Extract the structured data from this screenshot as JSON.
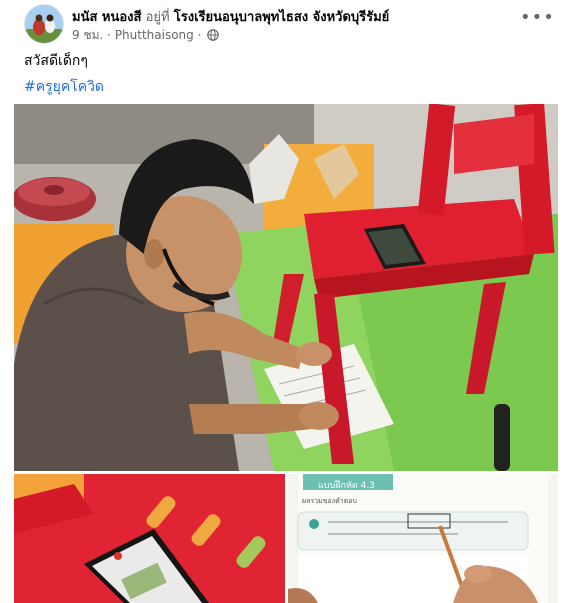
{
  "post": {
    "author_name": "มนัส หนองสี",
    "at_word": "อยู่ที่",
    "place_name": "โรงเรียนอนุบาลพุทไธสง จังหวัดบุรีรัมย์",
    "time": "9 ชม.",
    "location": "Phutthaisong",
    "separator": "·",
    "privacy_icon": "globe-icon",
    "more_icon": "more-options-icon",
    "more_label": "•••",
    "text": "สวัสดีเด็กๆ",
    "hashtag": "#ครูยุคโควิด"
  },
  "photos": [
    {
      "subject": "teacher-with-phone-on-red-chair"
    },
    {
      "subject": "phone-closeup-on-red-chair"
    },
    {
      "subject": "worksheet-closeup",
      "worksheet_title": "แบบฝึกหัด 4.3",
      "worksheet_subtitle": "ผลรวมของคำตอบ"
    }
  ],
  "colors": {
    "link_blue": "#216fdb",
    "meta_gray": "#65676b",
    "chair_red": "#e02030",
    "table_green": "#7cc94f"
  }
}
